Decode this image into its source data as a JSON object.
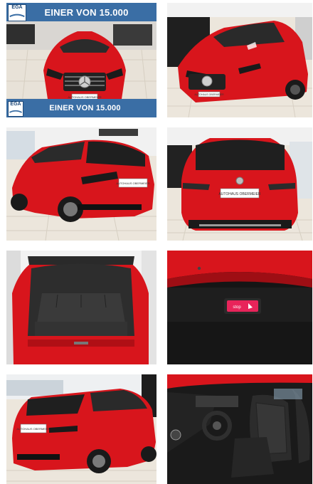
{
  "gallery": {
    "photos": [
      {
        "alt": "front-exterior"
      },
      {
        "alt": "front-three-quarter"
      },
      {
        "alt": "rear-three-quarter-left"
      },
      {
        "alt": "rear-view"
      },
      {
        "alt": "open-trunk"
      },
      {
        "alt": "tailgate-stop-button"
      },
      {
        "alt": "rear-side-view"
      },
      {
        "alt": "interior-cockpit"
      }
    ]
  },
  "promo": {
    "logo_text": "EGA",
    "banner_top": "EINER VON 15.000",
    "banner_bottom": "EINER VON 15.000"
  },
  "plates": {
    "front_1": "AUTOHAUS OBERMEIER",
    "front_2": "AUTOHAUS OBERMEIER",
    "rear_1": "AUTOHAUS OBERMEIER",
    "rear_2": "AUTOHAUS OBERMEIER",
    "rear_3": "AUTOHAUS OBERMEIER"
  },
  "tailgate": {
    "button_label": "stop"
  },
  "colors": {
    "car_red": "#d8151c",
    "banner_blue": "#3a6ea5",
    "floor_tile": "#efe8dc"
  }
}
